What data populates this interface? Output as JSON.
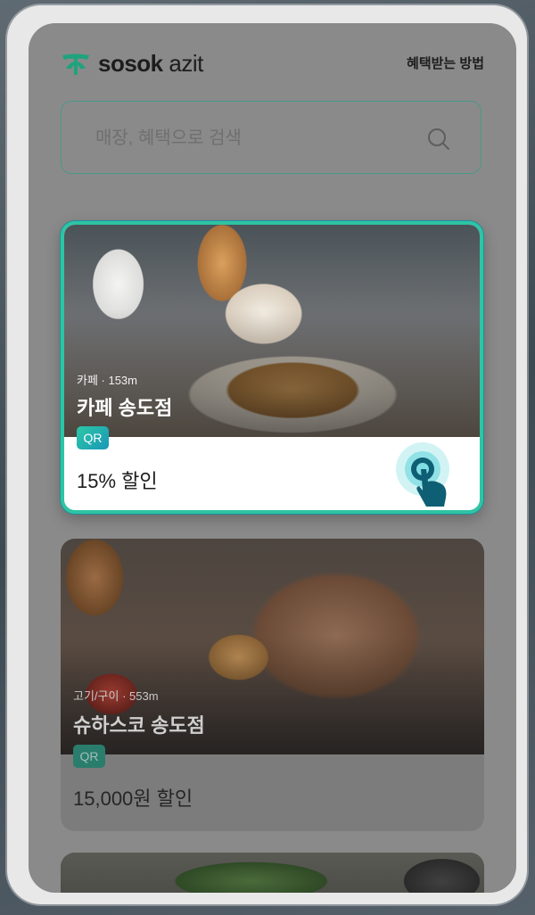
{
  "app": {
    "logo_text_bold": "sosok",
    "logo_text_light": " azit",
    "benefit_link": "혜택받는 방법"
  },
  "search": {
    "placeholder": "매장, 혜택으로 검색",
    "icon": "search-icon"
  },
  "cards": [
    {
      "category_distance": "카페 · 153m",
      "name": "카페 송도점",
      "badge": "QR",
      "discount": "15% 할인",
      "highlighted": true
    },
    {
      "category_distance": "고기/구이 · 553m",
      "name": "슈하스코 송도점",
      "badge": "QR",
      "discount": "15,000원 할인",
      "highlighted": false
    }
  ],
  "colors": {
    "accent": "#2fc4a3",
    "accent_dark": "#1b97b8",
    "logo_green": "#1fa37e"
  }
}
